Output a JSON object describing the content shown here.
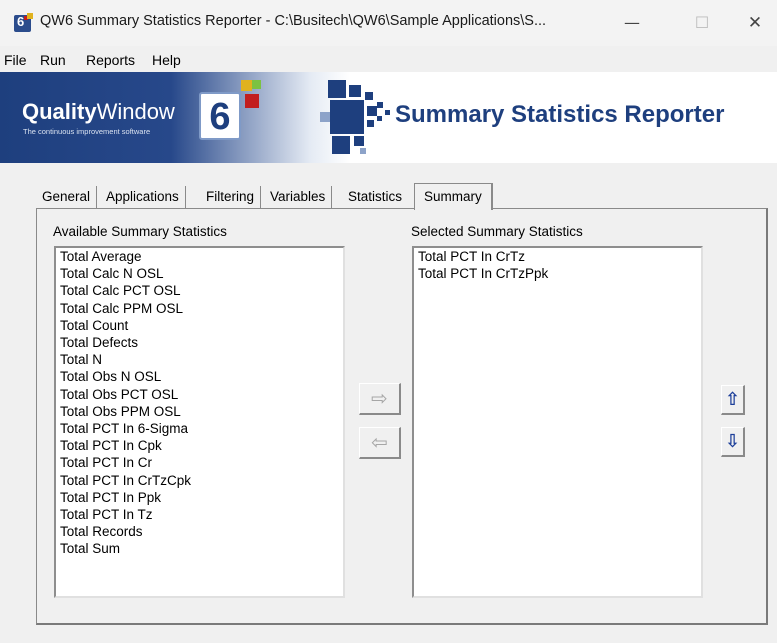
{
  "window": {
    "title": "QW6 Summary Statistics Reporter - C:\\Busitech\\QW6\\Sample Applications\\S...",
    "minimize_glyph": "—",
    "maximize_glyph": "☐",
    "close_glyph": "✕"
  },
  "menu": {
    "items": [
      "File",
      "Run",
      "Reports",
      "Help"
    ]
  },
  "banner": {
    "logo_bold": "Quality",
    "logo_light": "Window",
    "logo_tagline": "The continuous improvement software",
    "logo_number": "6",
    "title": "Summary Statistics Reporter",
    "brand_colors": {
      "navy": "#1e3f7e",
      "gold": "#e0b21f",
      "red": "#c21e1e",
      "green": "#7cc242"
    }
  },
  "tabs": [
    "General",
    "Applications",
    "Filtering",
    "Variables",
    "Statistics",
    "Summary"
  ],
  "active_tab": "Summary",
  "available": {
    "label": "Available Summary Statistics",
    "items": [
      "Total Average",
      "Total Calc N OSL",
      "Total Calc PCT OSL",
      "Total Calc PPM OSL",
      "Total Count",
      "Total Defects",
      "Total N",
      "Total Obs N OSL",
      "Total Obs PCT OSL",
      "Total Obs PPM OSL",
      "Total PCT In 6-Sigma",
      "Total PCT In Cpk",
      "Total PCT In Cr",
      "Total PCT In CrTzCpk",
      "Total PCT In Ppk",
      "Total PCT In Tz",
      "Total Records",
      "Total Sum"
    ]
  },
  "selected": {
    "label": "Selected Summary Statistics",
    "items": [
      "Total PCT In CrTz",
      "Total PCT In CrTzPpk"
    ]
  },
  "buttons": {
    "add_glyph": "⇨",
    "remove_glyph": "⇦",
    "move_up_glyph": "⇧",
    "move_down_glyph": "⇩"
  }
}
